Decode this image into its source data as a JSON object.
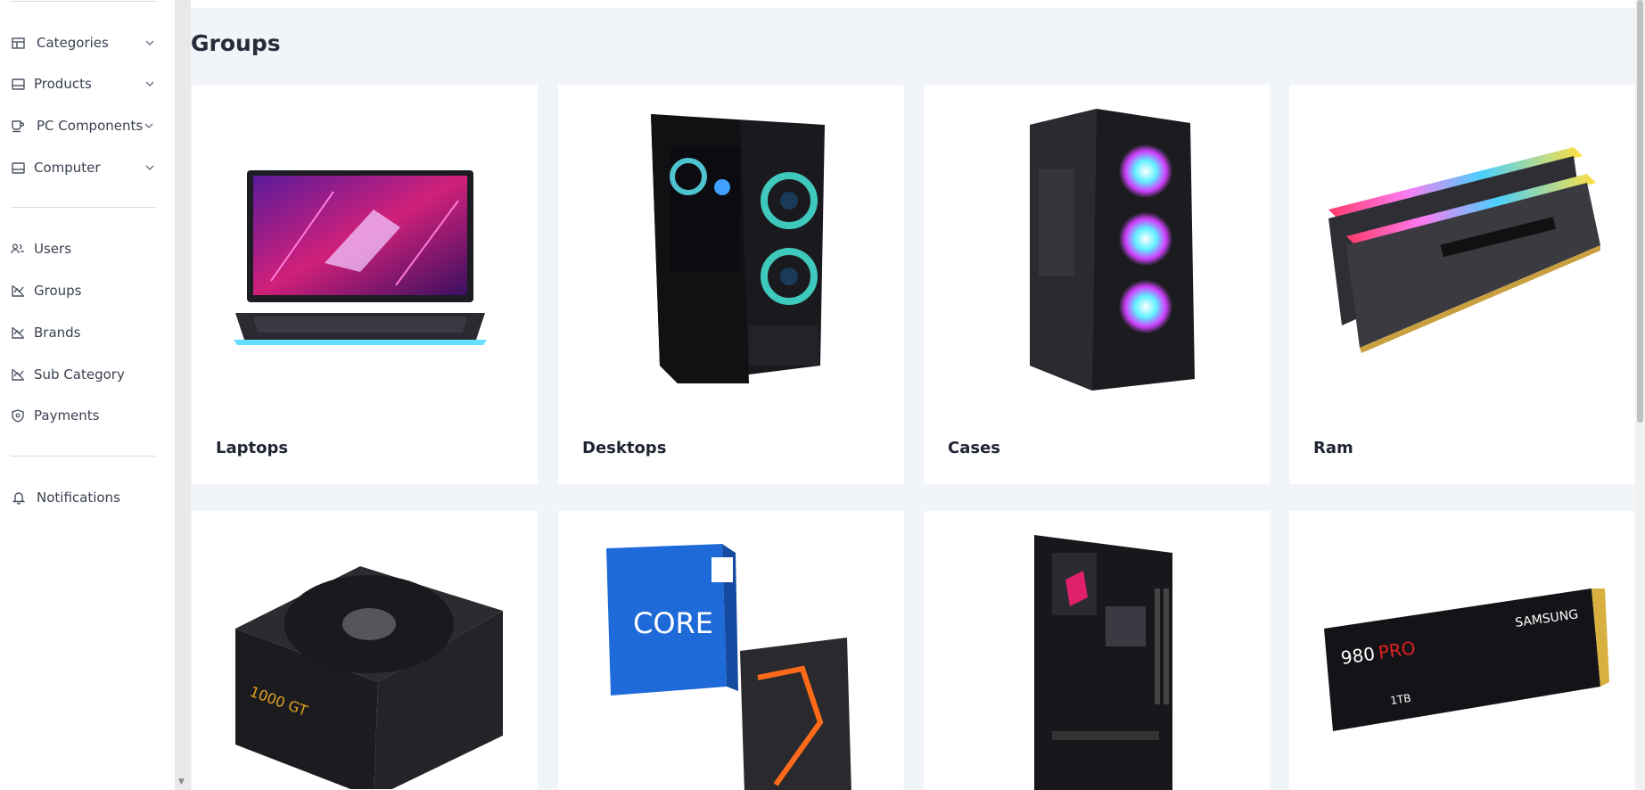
{
  "sidebar": {
    "items": [
      {
        "label": "Categories",
        "icon": "table-icon",
        "expandable": true
      },
      {
        "label": "Products",
        "icon": "panel-icon",
        "expandable": true
      },
      {
        "label": "PC Components",
        "icon": "cup-icon",
        "expandable": true
      },
      {
        "label": "Computer",
        "icon": "panel-icon",
        "expandable": true
      },
      {
        "label": "Users",
        "icon": "users-icon",
        "expandable": false
      },
      {
        "label": "Groups",
        "icon": "chart-icon",
        "expandable": false
      },
      {
        "label": "Brands",
        "icon": "chart-icon",
        "expandable": false
      },
      {
        "label": "Sub Category",
        "icon": "chart-icon",
        "expandable": false
      },
      {
        "label": "Payments",
        "icon": "shield-icon",
        "expandable": false
      },
      {
        "label": "Notifications",
        "icon": "bell-icon",
        "expandable": false
      }
    ]
  },
  "main": {
    "title": "Groups",
    "groups": [
      {
        "name": "Laptops",
        "image": "laptop-image"
      },
      {
        "name": "Desktops",
        "image": "desktop-pc-image"
      },
      {
        "name": "Cases",
        "image": "pc-case-image"
      },
      {
        "name": "Ram",
        "image": "ram-image"
      },
      {
        "name": "",
        "image": "power-supply-image"
      },
      {
        "name": "",
        "image": "cpu-boxes-image"
      },
      {
        "name": "",
        "image": "motherboard-image"
      },
      {
        "name": "",
        "image": "ssd-image"
      }
    ]
  },
  "colors": {
    "background": "#f1f4f9",
    "card": "#ffffff",
    "text": "#1f2533",
    "sidebar_text": "#3a4150"
  }
}
